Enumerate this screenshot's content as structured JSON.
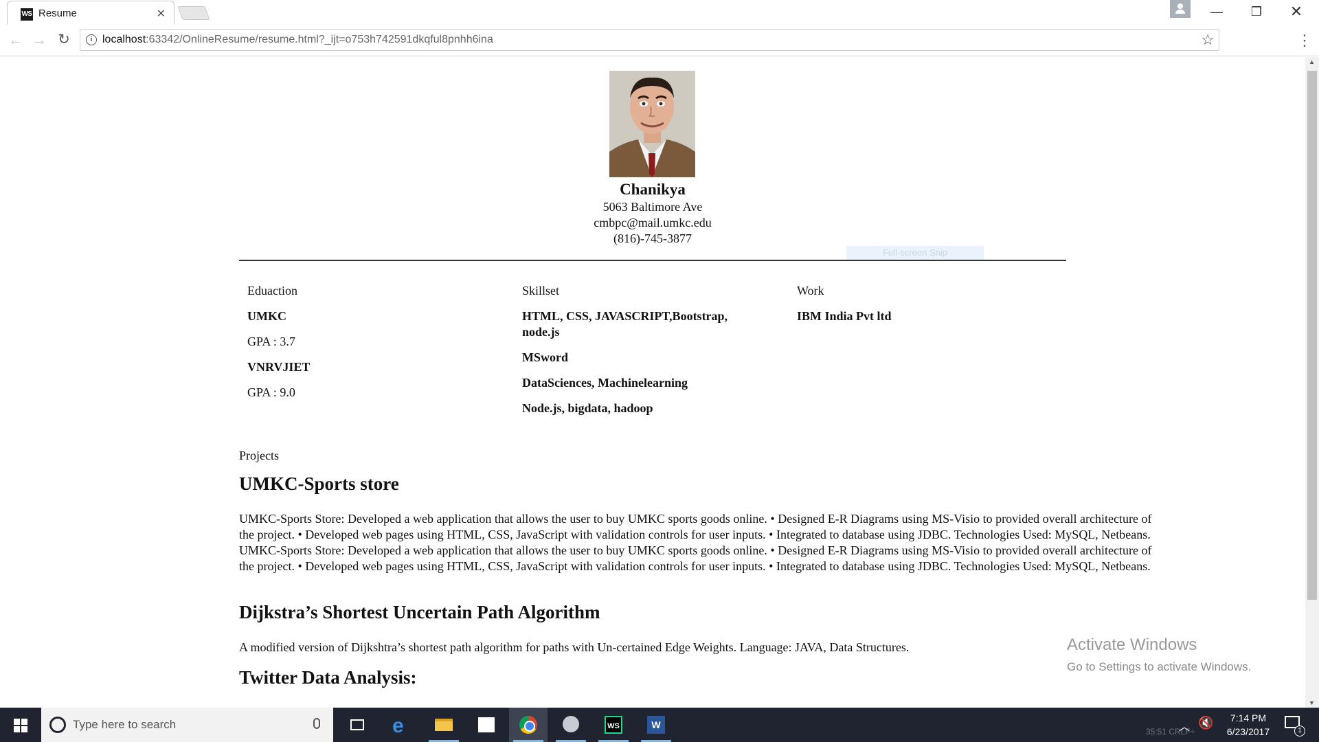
{
  "browser": {
    "tab_title": "Resume",
    "tab_favicon_text": "WS",
    "url_host": "localhost",
    "url_rest": ":63342/OnlineResume/resume.html?_ijt=o753h742591dkqful8pnhh6ina"
  },
  "resume": {
    "name": "Chanikya",
    "address": "5063 Baltimore Ave",
    "email": "cmbpc@mail.umkc.edu",
    "phone": "(816)-745-3877",
    "snip_hint": "Full-screen Snip",
    "education": {
      "heading": "Eduaction",
      "entries": [
        {
          "school": "UMKC",
          "gpa": "GPA : 3.7"
        },
        {
          "school": "VNRVJIET",
          "gpa": "GPA : 9.0"
        }
      ]
    },
    "skills": {
      "heading": "Skillset",
      "items": [
        "HTML, CSS, JAVASCRIPT,Bootstrap, node.js",
        "MSword",
        "DataSciences, Machinelearning",
        "Node.js, bigdata, hadoop"
      ]
    },
    "work": {
      "heading": "Work",
      "items": [
        "IBM India Pvt ltd"
      ]
    },
    "projects_label": "Projects",
    "projects": [
      {
        "title": "UMKC-Sports store",
        "description": "UMKC-Sports Store: Developed a web application that allows the user to buy UMKC sports goods online. • Designed E-R Diagrams using MS-Visio to provided overall architecture of the project. • Developed web pages using HTML, CSS, JavaScript with validation controls for user inputs. • Integrated to database using JDBC. Technologies Used: MySQL, Netbeans. UMKC-Sports Store: Developed a web application that allows the user to buy UMKC sports goods online. • Designed E-R Diagrams using MS-Visio to provided overall architecture of the project. • Developed web pages using HTML, CSS, JavaScript with validation controls for user inputs. • Integrated to database using JDBC. Technologies Used: MySQL, Netbeans."
      },
      {
        "title": "Dijkstra’s Shortest Uncertain Path Algorithm",
        "description": "A modified version of Dijkshtra’s shortest path algorithm for paths with Un-certained Edge Weights. Language: JAVA, Data Structures."
      },
      {
        "title": "Twitter Data Analysis:",
        "description": ""
      }
    ]
  },
  "watermark": {
    "title": "Activate Windows",
    "subtitle": "Go to Settings to activate Windows."
  },
  "taskbar": {
    "search_placeholder": "Type here to search",
    "time": "7:14 PM",
    "date": "6/23/2017",
    "notification_count": "1",
    "background_status": "35:51  CRLF÷"
  },
  "icons": {
    "back": "arrow-left-icon",
    "forward": "arrow-right-icon",
    "reload": "reload-icon",
    "info": "info-icon",
    "bookmark": "star-icon",
    "menu": "kebab-menu-icon",
    "start": "windows-logo-icon",
    "cortana": "cortana-circle-icon"
  },
  "colors": {
    "taskbar": "#1f2430",
    "active_underline": "#76b9ed",
    "page_text": "#111111"
  }
}
